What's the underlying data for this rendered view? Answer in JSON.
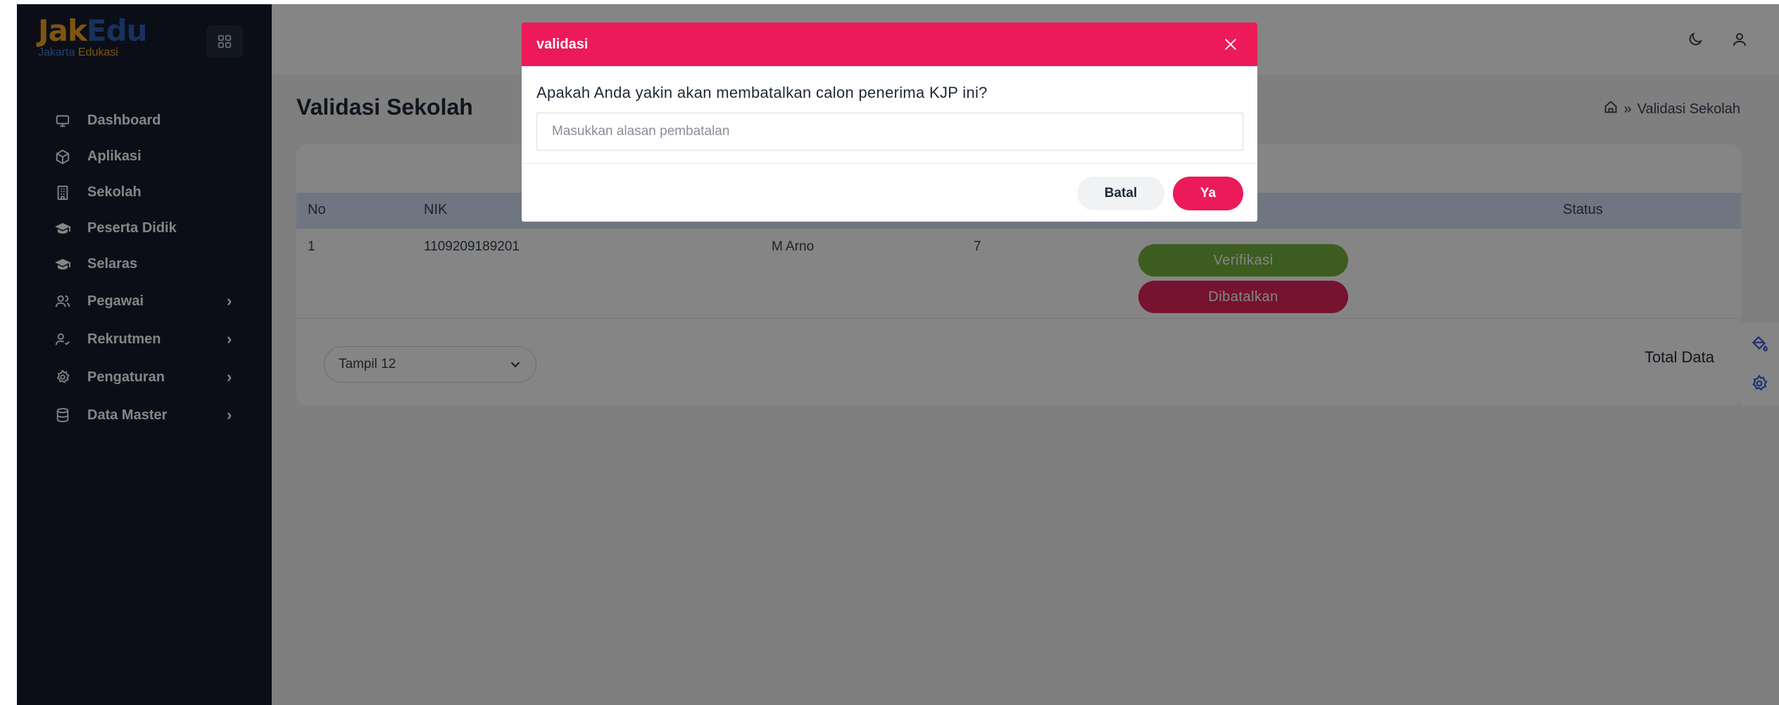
{
  "app": {
    "logo_main_1": "Jak",
    "logo_main_2": "Edu",
    "logo_sub_1": "Jakarta ",
    "logo_sub_2": "Edukasi"
  },
  "sidebar": {
    "items": [
      {
        "label": "Dashboard",
        "icon": "monitor-icon"
      },
      {
        "label": "Aplikasi",
        "icon": "box-icon"
      },
      {
        "label": "Sekolah",
        "icon": "building-icon"
      },
      {
        "label": "Peserta Didik",
        "icon": "graduation-cap-icon"
      },
      {
        "label": "Selaras",
        "icon": "graduation-cap-icon"
      },
      {
        "label": "Pegawai",
        "icon": "users-icon",
        "chevron": "›"
      },
      {
        "label": "Rekrutmen",
        "icon": "user-check-icon",
        "chevron": "›"
      },
      {
        "label": "Pengaturan",
        "icon": "gear-icon",
        "chevron": "›"
      },
      {
        "label": "Data Master",
        "icon": "database-icon",
        "chevron": "›"
      }
    ]
  },
  "page": {
    "title": "Validasi Sekolah",
    "breadcrumb_sep": "»",
    "breadcrumb_current": "Validasi Sekolah"
  },
  "table": {
    "headers": {
      "no": "No",
      "nik": "NIK",
      "status": "Status"
    },
    "rows": [
      {
        "no": "1",
        "nik": "1109209189201",
        "nama": "M Arno",
        "kelas": "7",
        "action_verify": "Verifikasi",
        "action_cancel": "Dibatalkan"
      }
    ]
  },
  "footer": {
    "page_size": "Tampil 12",
    "total_label": "Total Data"
  },
  "modal": {
    "title": "validasi",
    "question": "Apakah Anda yakin akan membatalkan calon penerima KJP ini?",
    "input_placeholder": "Masukkan alasan pembatalan",
    "cancel_label": "Batal",
    "confirm_label": "Ya"
  },
  "colors": {
    "sidebar_bg": "#161b2c",
    "accent": "#ec1a58",
    "verify": "#75b33f",
    "cancel": "#e0265f",
    "table_header": "#d7e3f8",
    "icon_blue": "#3b5bdb"
  }
}
